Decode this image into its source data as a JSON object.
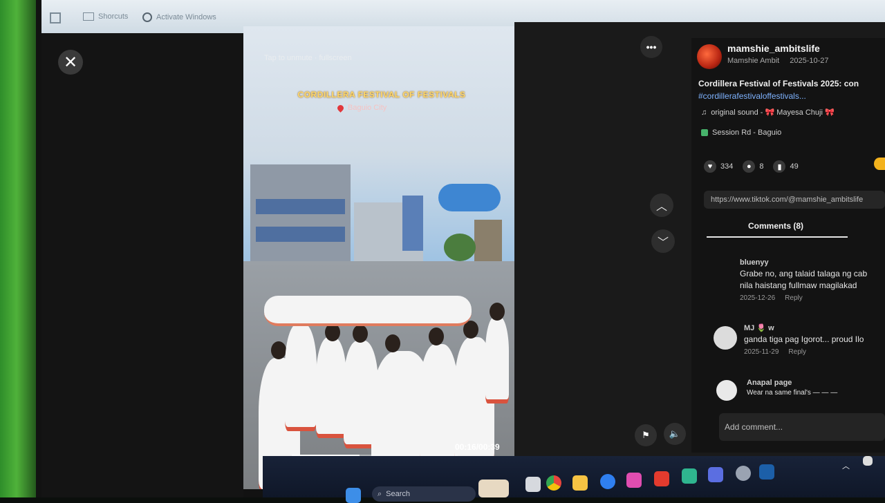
{
  "browser": {
    "tab1_label": "Shorcuts",
    "tab2_label": "Activate Windows"
  },
  "video": {
    "overlay_top": "Tap to unmute · fullscreen",
    "title": "CORDILLERA FESTIVAL OF FESTIVALS",
    "location": "Baguio City",
    "time": "00:16/00:39",
    "progress": 0.41
  },
  "post": {
    "username": "mamshie_ambitslife",
    "display_name": "Mamshie Ambit",
    "date": "2025-10-27",
    "description": "Cordillera Festival of Festivals 2025: con",
    "hashtags": "#cordillerafestivaloffestivals...",
    "sound": "original sound - 🎀 Mayesa Chuji 🎀",
    "place": "Session Rd - Baguio",
    "likes": "334",
    "comments_count": "8",
    "saves": "49",
    "link": "https://www.tiktok.com/@mamshie_ambitslife"
  },
  "tabs": {
    "comments_label": "Comments (8)"
  },
  "comments": [
    {
      "name": "bluenyy",
      "text": "Grabe no, ang talaid talaga ng cab",
      "text2": "nila haistang fullmaw magilakad",
      "date": "2025-12-26",
      "reply": "Reply"
    },
    {
      "name": "MJ 🌷 w",
      "text": "ganda tiga pag Igorot... proud Ilo",
      "date": "2025-11-29",
      "reply": "Reply"
    },
    {
      "name": "Anapal page",
      "text": "Wear na same final's — — —"
    }
  ],
  "add_comment_placeholder": "Add comment...",
  "taskbar": {
    "search_label": "Search"
  },
  "icons": {
    "close": "close-icon",
    "more": "more-icon",
    "up": "chevron-up-icon",
    "down": "chevron-down-icon",
    "heart": "heart-icon",
    "comment": "comment-icon",
    "bookmark": "bookmark-icon",
    "volume": "volume-icon",
    "report": "report-icon"
  },
  "colors": {
    "accent_yellow": "#f3b21d",
    "link_blue": "#7fb3ff",
    "panel_bg": "#131313"
  }
}
